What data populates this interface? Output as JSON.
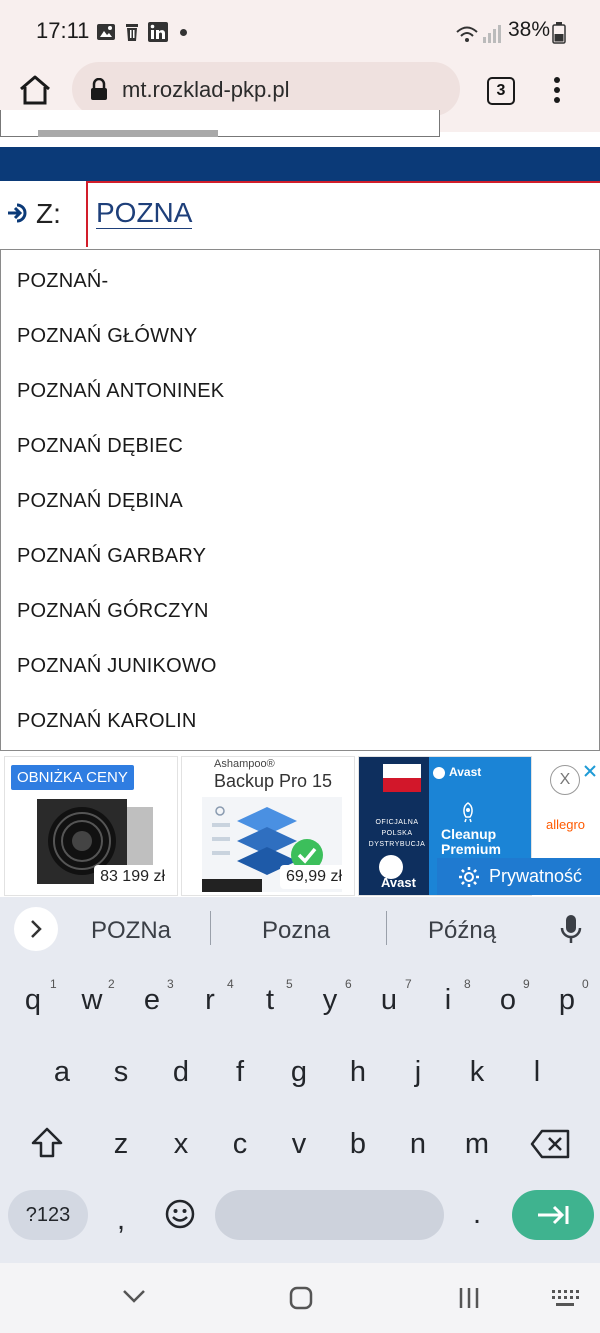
{
  "status": {
    "time": "17:11",
    "battery": "38%"
  },
  "browser": {
    "url": "mt.rozklad-pkp.pl",
    "tabs_count": "3"
  },
  "form": {
    "from_label": "Z:",
    "from_value": "POZNA"
  },
  "dropdown": {
    "items": [
      "POZNAŃ-",
      "POZNAŃ GŁÓWNY",
      "POZNAŃ ANTONINEK",
      "POZNAŃ DĘBIEC",
      "POZNAŃ DĘBINA",
      "POZNAŃ GARBARY",
      "POZNAŃ GÓRCZYN",
      "POZNAŃ JUNIKOWO",
      "POZNAŃ KAROLIN"
    ]
  },
  "ads": {
    "ad1": {
      "badge": "OBNIŻKA CENY",
      "price": "83 199 zł"
    },
    "ad2": {
      "brand": "Ashampoo®",
      "title": "Backup Pro 15",
      "price": "69,99 zł"
    },
    "ad3": {
      "brand": "Avast",
      "badge_lines": [
        "OFICJALNA",
        "POLSKA",
        "DYSTRYBUCJA"
      ],
      "product_line1": "Cleanup",
      "product_line2": "Premium",
      "logo": "Avast"
    },
    "ad4": {
      "brand": "allegro",
      "close": "X"
    },
    "privacy_label": "Prywatność"
  },
  "keyboard": {
    "suggestions": [
      "POZNa",
      "Pozna",
      "Późną"
    ],
    "row1": [
      "q",
      "w",
      "e",
      "r",
      "t",
      "y",
      "u",
      "i",
      "o",
      "p"
    ],
    "row1_hints": [
      "1",
      "2",
      "3",
      "4",
      "5",
      "6",
      "7",
      "8",
      "9",
      "0"
    ],
    "row2": [
      "a",
      "s",
      "d",
      "f",
      "g",
      "h",
      "j",
      "k",
      "l"
    ],
    "row3": [
      "z",
      "x",
      "c",
      "v",
      "b",
      "n",
      "m"
    ],
    "symbols_key": "?123",
    "comma": ",",
    "period": "."
  },
  "colors": {
    "accent_blue": "#0b3a78",
    "input_border": "#d21d2a",
    "enter_key": "#3fb38f"
  }
}
